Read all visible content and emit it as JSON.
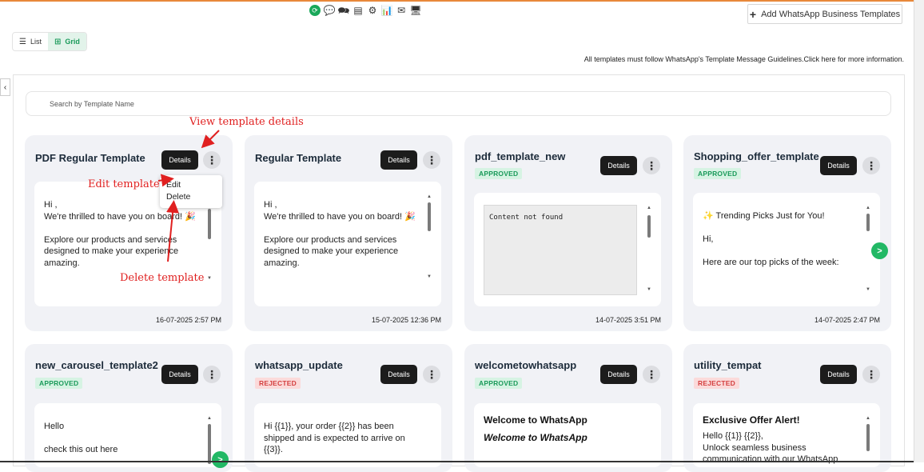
{
  "toolbar": {
    "icons": [
      "refresh-icon",
      "chat-plus-icon",
      "chat-bubbles-icon",
      "layout-icon",
      "network-icon",
      "chart-icon",
      "message-icon",
      "monitor-icon"
    ]
  },
  "header": {
    "add_button_label": "Add WhatsApp Business Templates"
  },
  "view_toggle": {
    "list_label": "List",
    "grid_label": "Grid",
    "active": "grid"
  },
  "guidelines_text": "All templates must follow WhatsApp's Template Message Guidelines.Click here for more information.",
  "search": {
    "placeholder": "Search by Template Name"
  },
  "colors": {
    "accent_green": "#1aa85a",
    "approved_bg": "#d6f3e3",
    "rejected_bg": "#fbdada",
    "annotation_red": "#e02020"
  },
  "cards": [
    {
      "name": "PDF Regular Template",
      "status": "",
      "details_label": "Details",
      "preview": "Hi ,\nWe're thrilled to have you on board! 🎉\n\nExplore our products and services\ndesigned to make your experience\namazing.",
      "timestamp": "16-07-2025 2:57 PM"
    },
    {
      "name": "Regular Template",
      "status": "",
      "details_label": "Details",
      "preview": "Hi ,\nWe're thrilled to have you on board! 🎉\n\nExplore our products and services\ndesigned to make your experience\namazing.",
      "timestamp": "15-07-2025 12:36 PM"
    },
    {
      "name": "pdf_template_new",
      "status": "APPROVED",
      "details_label": "Details",
      "preview": "Content not found",
      "timestamp": "14-07-2025 3:51 PM"
    },
    {
      "name": "Shopping_offer_template",
      "status": "APPROVED",
      "details_label": "Details",
      "preview": "✨ Trending Picks Just for You!\n\nHi,\n\nHere are our top picks of the week:",
      "timestamp": "14-07-2025 2:47 PM"
    },
    {
      "name": "new_carousel_template2",
      "status": "APPROVED",
      "details_label": "Details",
      "preview": "Hello\n\ncheck this out here"
    },
    {
      "name": "whatsapp_update",
      "status": "REJECTED",
      "details_label": "Details",
      "preview": "Hi {{1}}, your order {{2}} has been\nshipped and is expected to arrive on\n{{3}}."
    },
    {
      "name": "welcometowhatsapp",
      "status": "APPROVED",
      "details_label": "Details",
      "preview_title": "Welcome to WhatsApp",
      "preview_subtitle": "Welcome to WhatsApp"
    },
    {
      "name": "utility_tempat",
      "status": "REJECTED",
      "details_label": "Details",
      "preview_title": "Exclusive Offer Alert!",
      "preview": "Hello {{1}} {{2}},\nUnlock seamless business\ncommunication with our WhatsApp"
    }
  ],
  "dropdown_menu": {
    "items": [
      "Edit",
      "Delete"
    ]
  },
  "annotations": {
    "view": "View template details",
    "edit": "Edit template",
    "delete": "Delete template"
  }
}
